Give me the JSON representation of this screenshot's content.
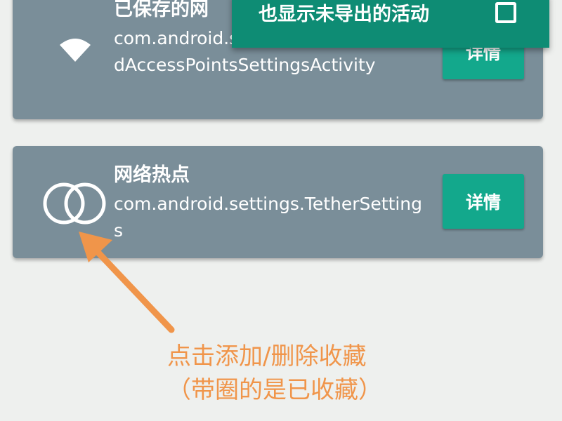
{
  "cards": [
    {
      "title": "已保存的网",
      "subtitle": "com.android.settings.Settings$SavedAccessPointsSettingsActivity",
      "icon": "wifi-icon",
      "button_label": "详情"
    },
    {
      "title": "网络热点",
      "subtitle": "com.android.settings.TetherSettings",
      "icon": "hotspot-rings-icon",
      "button_label": "详情"
    }
  ],
  "popup": {
    "label": "也显示未导出的活动",
    "checked": false
  },
  "annotation": {
    "line1": "点击添加/删除收藏",
    "line2": "（带圈的是已收藏）",
    "color": "#f0954a"
  },
  "colors": {
    "card_bg": "#7a8e99",
    "button_bg": "#13a88c",
    "popup_bg": "#0e8c74",
    "page_bg": "#eef0ee"
  }
}
